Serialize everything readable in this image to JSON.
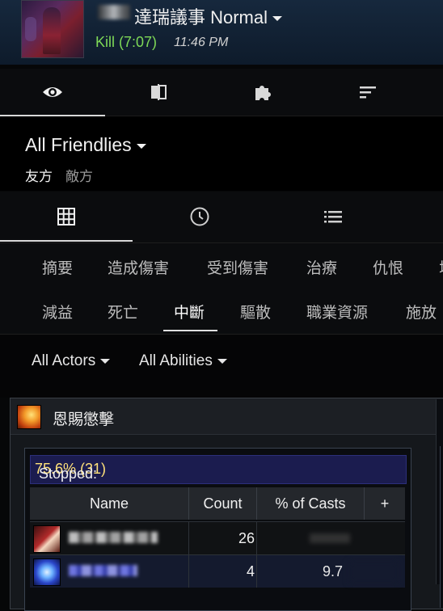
{
  "header": {
    "title": "達瑞議事 Normal",
    "kill_status": "Kill (7:07)",
    "time": "11:46 PM"
  },
  "top_nav": {
    "tabs": [
      {
        "icon": "eye-icon",
        "active": true
      },
      {
        "icon": "compare-icon",
        "active": false
      },
      {
        "icon": "puzzle-icon",
        "active": false
      },
      {
        "icon": "sort-icon",
        "active": false
      }
    ]
  },
  "filter": {
    "scope_label": "All Friendlies",
    "side_tabs": [
      "友方",
      "敵方"
    ]
  },
  "view_tabs": [
    {
      "icon": "grid-icon",
      "active": true
    },
    {
      "icon": "clock-icon",
      "active": false
    },
    {
      "icon": "list-icon",
      "active": false
    }
  ],
  "categories": {
    "row1": [
      "摘要",
      "造成傷害",
      "受到傷害",
      "治療",
      "仇恨"
    ],
    "row2": [
      "減益",
      "死亡",
      "中斷",
      "驅散",
      "職業資源",
      "施放"
    ],
    "active": "中斷"
  },
  "filters": {
    "actors": "All Actors",
    "abilities": "All Abilities"
  },
  "ability": {
    "name": "恩賜懲擊",
    "stopped_label": "Stopped:",
    "stopped_value": "75.6% (31)",
    "columns": {
      "name": "Name",
      "count": "Count",
      "pct": "% of Casts",
      "add": "+"
    },
    "rows": [
      {
        "count": "26",
        "pct": ""
      },
      {
        "count": "4",
        "pct": "9.7"
      }
    ]
  },
  "colors": {
    "kill_green": "#7ed957",
    "stopped_bg": "#1b1c4f",
    "highlight_yellow": "#ffe27a"
  }
}
